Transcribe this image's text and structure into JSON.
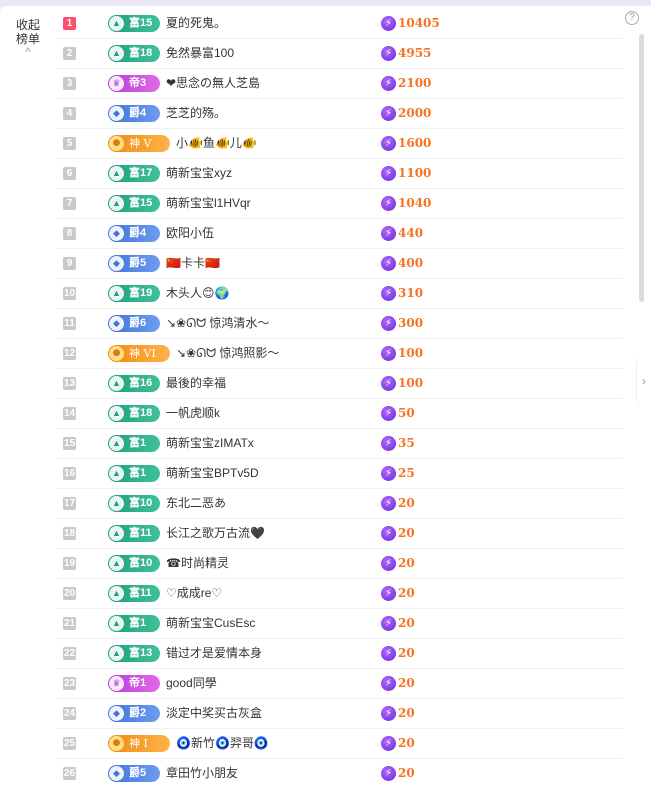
{
  "collapse": {
    "line1": "收起",
    "line2": "榜单",
    "chevron": "^"
  },
  "help": {
    "label": "?"
  },
  "side_toggle": {
    "label": "›"
  },
  "rows": [
    {
      "rank": "1",
      "level_class": "fu",
      "level": "富15",
      "level_icon": "▲",
      "name": "夏的死鬼。",
      "score": "10405"
    },
    {
      "rank": "2",
      "level_class": "fu",
      "level": "富18",
      "level_icon": "▲",
      "name": "免然暴富100",
      "score": "4955"
    },
    {
      "rank": "3",
      "level_class": "di",
      "level": "帝3",
      "level_icon": "♛",
      "name": "❤思念の無人芝島",
      "score": "2100"
    },
    {
      "rank": "4",
      "level_class": "jue",
      "level": "爵4",
      "level_icon": "◆",
      "name": "芝芝的殇。",
      "score": "2000"
    },
    {
      "rank": "5",
      "level_class": "shen",
      "level": "神 V",
      "level_icon": "●",
      "name": "小🐠鱼🐠儿🐠",
      "score": "1600",
      "wide": true
    },
    {
      "rank": "6",
      "level_class": "fu",
      "level": "富17",
      "level_icon": "▲",
      "name": "萌新宝宝xyz",
      "score": "1100"
    },
    {
      "rank": "7",
      "level_class": "fu",
      "level": "富15",
      "level_icon": "▲",
      "name": "萌新宝宝l1HVqr",
      "score": "1040"
    },
    {
      "rank": "8",
      "level_class": "jue",
      "level": "爵4",
      "level_icon": "◆",
      "name": "欧阳小伍",
      "score": "440"
    },
    {
      "rank": "9",
      "level_class": "jue",
      "level": "爵5",
      "level_icon": "◆",
      "name": "🇨🇳卡卡🇨🇳",
      "score": "400"
    },
    {
      "rank": "10",
      "level_class": "fu",
      "level": "富19",
      "level_icon": "▲",
      "name": "木头人😊🌍",
      "score": "310"
    },
    {
      "rank": "11",
      "level_class": "jue",
      "level": "爵6",
      "level_icon": "◆",
      "name": "↘❀ᘏᗢ 惊鸿清水～",
      "score": "300"
    },
    {
      "rank": "12",
      "level_class": "shen",
      "level": "神 VI",
      "level_icon": "●",
      "name": "↘❀ᘏᗢ 惊鸿照影～",
      "score": "100",
      "wide": true
    },
    {
      "rank": "13",
      "level_class": "fu",
      "level": "富16",
      "level_icon": "▲",
      "name": "最後的幸福",
      "score": "100"
    },
    {
      "rank": "14",
      "level_class": "fu",
      "level": "富18",
      "level_icon": "▲",
      "name": "一帆虎顺k",
      "score": "50"
    },
    {
      "rank": "15",
      "level_class": "fu",
      "level": "富1",
      "level_icon": "▲",
      "name": "萌新宝宝zIMATx",
      "score": "35"
    },
    {
      "rank": "16",
      "level_class": "fu",
      "level": "富1",
      "level_icon": "▲",
      "name": "萌新宝宝BPTv5D",
      "score": "25"
    },
    {
      "rank": "17",
      "level_class": "fu",
      "level": "富10",
      "level_icon": "▲",
      "name": "东北二恶あ",
      "score": "20"
    },
    {
      "rank": "18",
      "level_class": "fu",
      "level": "富11",
      "level_icon": "▲",
      "name": "长江之歌万古流🖤",
      "score": "20"
    },
    {
      "rank": "19",
      "level_class": "fu",
      "level": "富10",
      "level_icon": "▲",
      "name": "☎时尚精灵",
      "score": "20"
    },
    {
      "rank": "20",
      "level_class": "fu",
      "level": "富11",
      "level_icon": "▲",
      "name": "♡成成re♡",
      "score": "20"
    },
    {
      "rank": "21",
      "level_class": "fu",
      "level": "富1",
      "level_icon": "▲",
      "name": "萌新宝宝CusEsc",
      "score": "20"
    },
    {
      "rank": "22",
      "level_class": "fu",
      "level": "富13",
      "level_icon": "▲",
      "name": "错过才是爱情本身",
      "score": "20"
    },
    {
      "rank": "23",
      "level_class": "di",
      "level": "帝1",
      "level_icon": "♛",
      "name": "good同學",
      "score": "20"
    },
    {
      "rank": "24",
      "level_class": "jue",
      "level": "爵2",
      "level_icon": "◆",
      "name": "淡定中奖买古灰盒",
      "score": "20"
    },
    {
      "rank": "25",
      "level_class": "shen",
      "level": "神 I",
      "level_icon": "●",
      "name": "🧿新竹🧿羿哥🧿",
      "score": "20",
      "wide": true
    },
    {
      "rank": "26",
      "level_class": "jue",
      "level": "爵5",
      "level_icon": "◆",
      "name": "章田竹小朋友",
      "score": "20"
    }
  ]
}
